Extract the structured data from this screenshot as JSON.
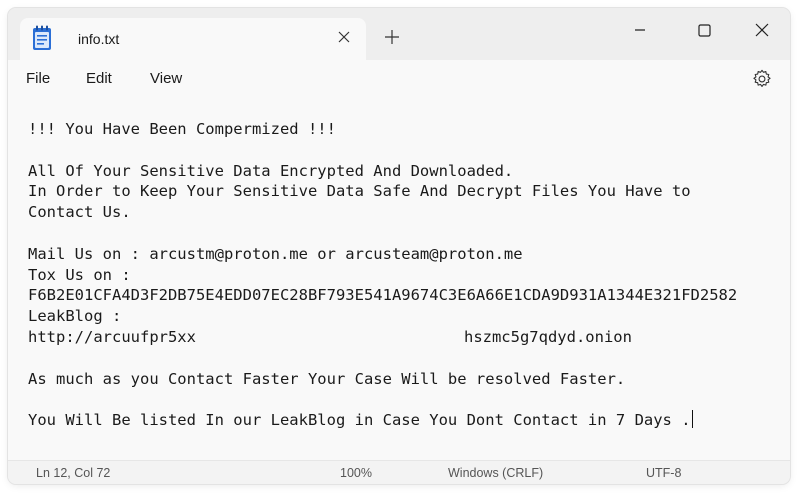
{
  "tab": {
    "title": "info.txt",
    "file_icon": "notepad-file-icon",
    "close_icon": "close-icon",
    "new_tab_icon": "plus-icon"
  },
  "window_controls": [
    "minimize-icon",
    "maximize-icon",
    "close-icon"
  ],
  "menu": {
    "items": [
      "File",
      "Edit",
      "View"
    ],
    "settings_icon": "gear-icon"
  },
  "document": {
    "lines": [
      "!!! You Have Been Compermized !!!",
      "",
      "All Of Your Sensitive Data Encrypted And Downloaded.",
      "In Order to Keep Your Sensitive Data Safe And Decrypt Files You Have to",
      "Contact Us.",
      "",
      "Mail Us on : arcustm@proton.me or arcusteam@proton.me",
      "Tox Us on :",
      "F6B2E01CFA4D3F2DB75E4EDD07EC28BF793E541A9674C3E6A66E1CDA9D931A1344E321FD2582",
      "LeakBlog :",
      "",
      "",
      "As much as you Contact Faster Your Case Will be resolved Faster.",
      "",
      "You Will Be listed In our LeakBlog in Case You Dont Contact in 7 Days ."
    ],
    "leakblog_url_start": "http://arcuufpr5xx",
    "leakblog_url_end": "hszmc5g7qdyd.onion"
  },
  "status": {
    "position": "Ln 12, Col 72",
    "zoom": "100%",
    "line_ending": "Windows (CRLF)",
    "encoding": "UTF-8"
  },
  "colors": {
    "titlebar": "#eeeeee",
    "editor_bg": "#f9f9f9",
    "text": "#1a1a1a",
    "status_text": "#555555"
  }
}
